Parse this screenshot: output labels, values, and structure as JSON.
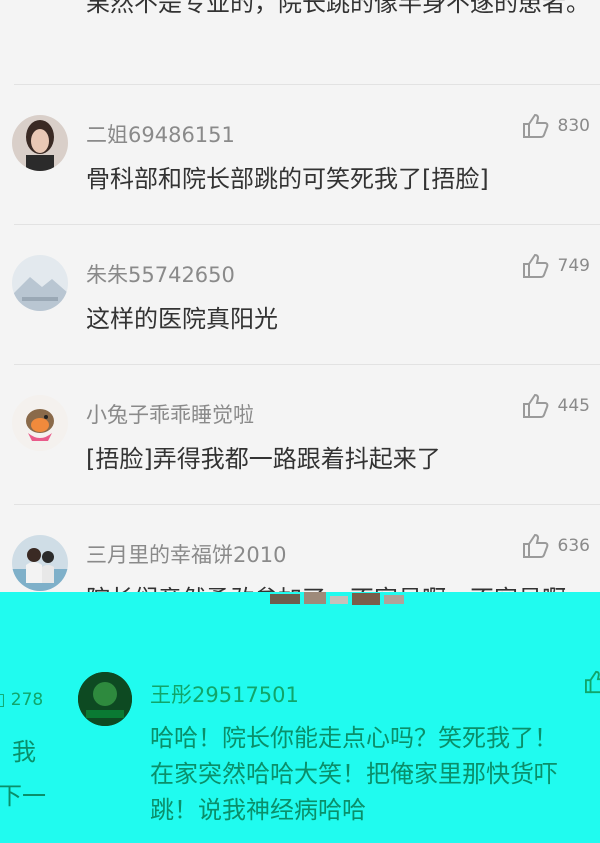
{
  "top_comment": {
    "text": "果然不是专业的，院长跳的像半身不遂的患者。"
  },
  "comments": [
    {
      "username": "二姐69486151",
      "text": "骨科部和院长部跳的可笑死我了[捂脸]",
      "likes": "830"
    },
    {
      "username": "朱朱55742650",
      "text": "这样的医院真阳光",
      "likes": "749"
    },
    {
      "username": "小兔子乖乖睡觉啦",
      "text": "[捂脸]弄得我都一路跟着抖起来了",
      "likes": "445"
    },
    {
      "username": "三月里的幸福饼2010",
      "text": "院长们竟然勇敢参加了，不容易啊，不容易啊",
      "likes": "636"
    }
  ],
  "overlay": {
    "left_likes": "278",
    "left_text_1": "我",
    "left_text_2": "下一",
    "username": "王彤29517501",
    "lines": [
      "哈哈！院长你能走点心吗？笑死我了！",
      "在家突然哈哈大笑！把俺家里那快货吓",
      "跳！说我神经病哈哈"
    ]
  },
  "colors": {
    "background": "#f4f4f4",
    "overlay": "#20fbef",
    "overlay_text": "#0a8f6a",
    "username": "#8a8a8a",
    "body_text": "#333333"
  },
  "icons": {
    "like": "thumbs-up-icon"
  }
}
